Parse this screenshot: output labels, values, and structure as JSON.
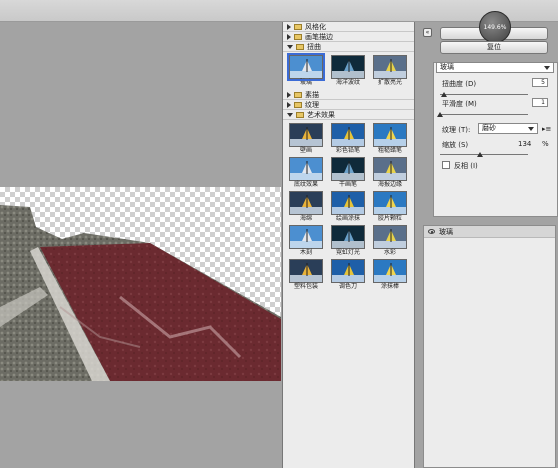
{
  "zoom_badge": "149.6%",
  "buttons": {
    "ok": "确定",
    "reset": "复位"
  },
  "categories": [
    {
      "label": "风格化",
      "open": false
    },
    {
      "label": "画笔描边",
      "open": false
    },
    {
      "label": "扭曲",
      "open": true,
      "filters": [
        "玻璃",
        "海洋波纹",
        "扩散亮光"
      ],
      "selected": 0
    },
    {
      "label": "素描",
      "open": false
    },
    {
      "label": "纹理",
      "open": false
    },
    {
      "label": "艺术效果",
      "open": true,
      "filters": [
        "壁画",
        "彩色铅笔",
        "粗糙蜡笔",
        "底纹效果",
        "干画笔",
        "海报边缘",
        "海绵",
        "绘画涂抹",
        "胶片颗粒",
        "木刻",
        "霓虹灯光",
        "水彩",
        "塑料包装",
        "调色刀",
        "涂抹棒"
      ]
    }
  ],
  "settings": {
    "filter_select": "玻璃",
    "distortion_label": "扭曲度 (D)",
    "distortion_value": "5",
    "distortion_level": 0.05,
    "smoothness_label": "平滑度 (M)",
    "smoothness_value": "1",
    "smoothness_level": 0.0,
    "texture_label": "纹理 (T):",
    "texture_value": "磨砂",
    "texture_menu_icon": "menu-icon",
    "scaling_label": "缩放 (S)",
    "scaling_value": "134",
    "scaling_unit": "%",
    "scaling_level": 0.45,
    "invert_label": "反相 (I)",
    "invert_checked": false
  },
  "layers": [
    {
      "label": "玻璃",
      "visible": true
    }
  ],
  "colors": {
    "accent": "#3b6bd6",
    "road": "#6e2a30",
    "panel": "#ececec",
    "background": "#a3a3a3"
  }
}
